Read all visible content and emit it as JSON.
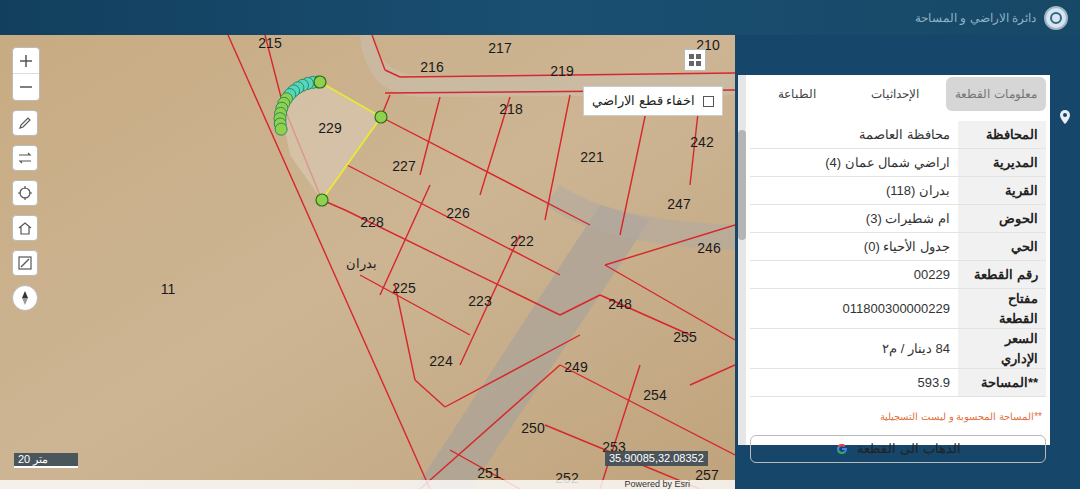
{
  "header": {
    "title": "دائرة الاراضي و المساحة"
  },
  "map": {
    "parcels": [
      {
        "label": "215",
        "selected": false
      },
      {
        "label": "217",
        "selected": false
      },
      {
        "label": "210",
        "selected": false
      },
      {
        "label": "216",
        "selected": false
      },
      {
        "label": "219",
        "selected": false
      },
      {
        "label": "218",
        "selected": false
      },
      {
        "label": "229",
        "selected": true
      },
      {
        "label": "242",
        "selected": false
      },
      {
        "label": "221",
        "selected": false
      },
      {
        "label": "227",
        "selected": false
      },
      {
        "label": "247",
        "selected": false
      },
      {
        "label": "228",
        "selected": false
      },
      {
        "label": "226",
        "selected": false
      },
      {
        "label": "222",
        "selected": false
      },
      {
        "label": "246",
        "selected": false
      },
      {
        "label": "11",
        "selected": false
      },
      {
        "label": "225",
        "selected": false
      },
      {
        "label": "223",
        "selected": false
      },
      {
        "label": "248",
        "selected": false
      },
      {
        "label": "255",
        "selected": false
      },
      {
        "label": "224",
        "selected": false
      },
      {
        "label": "249",
        "selected": false
      },
      {
        "label": "254",
        "selected": false
      },
      {
        "label": "250",
        "selected": false
      },
      {
        "label": "253",
        "selected": false
      },
      {
        "label": "251",
        "selected": false
      },
      {
        "label": "252",
        "selected": false
      },
      {
        "label": "257",
        "selected": false
      }
    ],
    "area_label": "بدران",
    "layer_toggle": {
      "label": "اخفاء قطع الاراضي",
      "checked": false
    },
    "scale": "20 متر",
    "coordinates": "35.90085,32.08352",
    "attribution": "Powered by Esri"
  },
  "panel": {
    "tabs": [
      {
        "label": "معلومات القطعة",
        "selected": true
      },
      {
        "label": "الإحداثيات",
        "selected": false
      },
      {
        "label": "الطباعة",
        "selected": false
      }
    ],
    "rows": [
      {
        "label": "المحافظة",
        "value": "محافظة العاصمة"
      },
      {
        "label": "المديرية",
        "value": "اراضي شمال عمان (4)"
      },
      {
        "label": "القرية",
        "value": "بدران (118)"
      },
      {
        "label": "الحوض",
        "value": "ام شطيرات (3)"
      },
      {
        "label": "الحي",
        "value": "جدول الأحياء (0)"
      },
      {
        "label": "رقم القطعة",
        "value": "00229"
      },
      {
        "label": "مفتاح القطعة",
        "value": "011800300000229"
      },
      {
        "label": "السعر الإداري",
        "value": "84 دينار / م٢"
      },
      {
        "label": "**المساحة",
        "value": "593.9"
      }
    ],
    "note": "**المساحة المحسوبة و ليست التسجيلية",
    "button": "الذهاب الى القطعة"
  }
}
